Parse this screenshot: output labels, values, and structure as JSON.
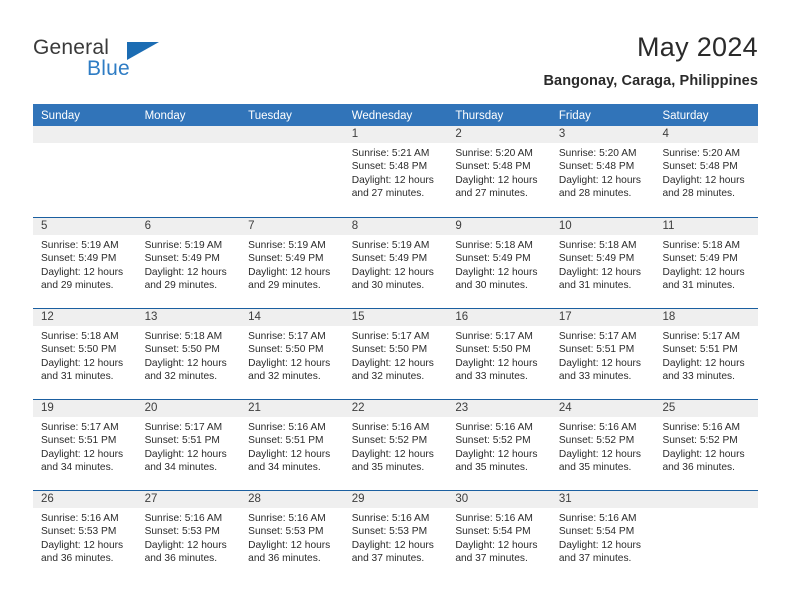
{
  "brand": {
    "name_part1": "General",
    "name_part2": "Blue",
    "logo_icon": "triangle-flag-icon"
  },
  "header": {
    "title": "May 2024",
    "subtitle": "Bangonay, Caraga, Philippines"
  },
  "colors": {
    "header_blue": "#3174b9",
    "row_divider": "#1b5fa0",
    "daynum_band": "#efefef",
    "brand_blue": "#2e7cc4"
  },
  "weekdays": [
    "Sunday",
    "Monday",
    "Tuesday",
    "Wednesday",
    "Thursday",
    "Friday",
    "Saturday"
  ],
  "weeks": [
    [
      {
        "day": "",
        "info": ""
      },
      {
        "day": "",
        "info": ""
      },
      {
        "day": "",
        "info": ""
      },
      {
        "day": "1",
        "info": "Sunrise: 5:21 AM\nSunset: 5:48 PM\nDaylight: 12 hours\nand 27 minutes."
      },
      {
        "day": "2",
        "info": "Sunrise: 5:20 AM\nSunset: 5:48 PM\nDaylight: 12 hours\nand 27 minutes."
      },
      {
        "day": "3",
        "info": "Sunrise: 5:20 AM\nSunset: 5:48 PM\nDaylight: 12 hours\nand 28 minutes."
      },
      {
        "day": "4",
        "info": "Sunrise: 5:20 AM\nSunset: 5:48 PM\nDaylight: 12 hours\nand 28 minutes."
      }
    ],
    [
      {
        "day": "5",
        "info": "Sunrise: 5:19 AM\nSunset: 5:49 PM\nDaylight: 12 hours\nand 29 minutes."
      },
      {
        "day": "6",
        "info": "Sunrise: 5:19 AM\nSunset: 5:49 PM\nDaylight: 12 hours\nand 29 minutes."
      },
      {
        "day": "7",
        "info": "Sunrise: 5:19 AM\nSunset: 5:49 PM\nDaylight: 12 hours\nand 29 minutes."
      },
      {
        "day": "8",
        "info": "Sunrise: 5:19 AM\nSunset: 5:49 PM\nDaylight: 12 hours\nand 30 minutes."
      },
      {
        "day": "9",
        "info": "Sunrise: 5:18 AM\nSunset: 5:49 PM\nDaylight: 12 hours\nand 30 minutes."
      },
      {
        "day": "10",
        "info": "Sunrise: 5:18 AM\nSunset: 5:49 PM\nDaylight: 12 hours\nand 31 minutes."
      },
      {
        "day": "11",
        "info": "Sunrise: 5:18 AM\nSunset: 5:49 PM\nDaylight: 12 hours\nand 31 minutes."
      }
    ],
    [
      {
        "day": "12",
        "info": "Sunrise: 5:18 AM\nSunset: 5:50 PM\nDaylight: 12 hours\nand 31 minutes."
      },
      {
        "day": "13",
        "info": "Sunrise: 5:18 AM\nSunset: 5:50 PM\nDaylight: 12 hours\nand 32 minutes."
      },
      {
        "day": "14",
        "info": "Sunrise: 5:17 AM\nSunset: 5:50 PM\nDaylight: 12 hours\nand 32 minutes."
      },
      {
        "day": "15",
        "info": "Sunrise: 5:17 AM\nSunset: 5:50 PM\nDaylight: 12 hours\nand 32 minutes."
      },
      {
        "day": "16",
        "info": "Sunrise: 5:17 AM\nSunset: 5:50 PM\nDaylight: 12 hours\nand 33 minutes."
      },
      {
        "day": "17",
        "info": "Sunrise: 5:17 AM\nSunset: 5:51 PM\nDaylight: 12 hours\nand 33 minutes."
      },
      {
        "day": "18",
        "info": "Sunrise: 5:17 AM\nSunset: 5:51 PM\nDaylight: 12 hours\nand 33 minutes."
      }
    ],
    [
      {
        "day": "19",
        "info": "Sunrise: 5:17 AM\nSunset: 5:51 PM\nDaylight: 12 hours\nand 34 minutes."
      },
      {
        "day": "20",
        "info": "Sunrise: 5:17 AM\nSunset: 5:51 PM\nDaylight: 12 hours\nand 34 minutes."
      },
      {
        "day": "21",
        "info": "Sunrise: 5:16 AM\nSunset: 5:51 PM\nDaylight: 12 hours\nand 34 minutes."
      },
      {
        "day": "22",
        "info": "Sunrise: 5:16 AM\nSunset: 5:52 PM\nDaylight: 12 hours\nand 35 minutes."
      },
      {
        "day": "23",
        "info": "Sunrise: 5:16 AM\nSunset: 5:52 PM\nDaylight: 12 hours\nand 35 minutes."
      },
      {
        "day": "24",
        "info": "Sunrise: 5:16 AM\nSunset: 5:52 PM\nDaylight: 12 hours\nand 35 minutes."
      },
      {
        "day": "25",
        "info": "Sunrise: 5:16 AM\nSunset: 5:52 PM\nDaylight: 12 hours\nand 36 minutes."
      }
    ],
    [
      {
        "day": "26",
        "info": "Sunrise: 5:16 AM\nSunset: 5:53 PM\nDaylight: 12 hours\nand 36 minutes."
      },
      {
        "day": "27",
        "info": "Sunrise: 5:16 AM\nSunset: 5:53 PM\nDaylight: 12 hours\nand 36 minutes."
      },
      {
        "day": "28",
        "info": "Sunrise: 5:16 AM\nSunset: 5:53 PM\nDaylight: 12 hours\nand 36 minutes."
      },
      {
        "day": "29",
        "info": "Sunrise: 5:16 AM\nSunset: 5:53 PM\nDaylight: 12 hours\nand 37 minutes."
      },
      {
        "day": "30",
        "info": "Sunrise: 5:16 AM\nSunset: 5:54 PM\nDaylight: 12 hours\nand 37 minutes."
      },
      {
        "day": "31",
        "info": "Sunrise: 5:16 AM\nSunset: 5:54 PM\nDaylight: 12 hours\nand 37 minutes."
      },
      {
        "day": "",
        "info": ""
      }
    ]
  ]
}
